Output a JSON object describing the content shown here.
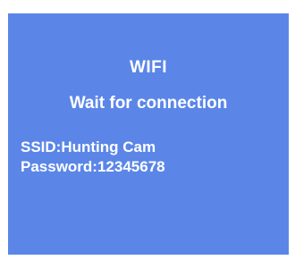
{
  "screen": {
    "title": "WIFI",
    "status": "Wait for connection",
    "ssid_line": "SSID:Hunting Cam",
    "password_line": "Password:12345678",
    "background_color": "#5b86e8",
    "text_color": "#ffffff"
  }
}
